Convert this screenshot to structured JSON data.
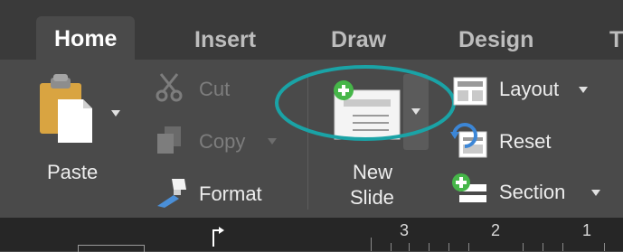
{
  "tabs": {
    "home": "Home",
    "insert": "Insert",
    "draw": "Draw",
    "design": "Design",
    "partial": "T"
  },
  "clipboard": {
    "paste_label": "Paste",
    "cut_label": "Cut",
    "copy_label": "Copy",
    "format_label": "Format"
  },
  "slides": {
    "new_slide_line1": "New",
    "new_slide_line2": "Slide",
    "layout_label": "Layout",
    "reset_label": "Reset",
    "section_label": "Section"
  },
  "ruler": {
    "marks": [
      "3",
      "2",
      "1"
    ]
  },
  "colors": {
    "highlight_circle": "#1aa3a6",
    "accent_green": "#46b649",
    "tab_bar_bg": "#3a3a3a",
    "ribbon_bg": "#4a4a4a"
  },
  "icons": [
    "clipboard-icon",
    "scissors-icon",
    "copy-icon",
    "format-painter-icon",
    "new-slide-icon",
    "layout-icon",
    "reset-icon",
    "section-icon",
    "indent-marker-icon"
  ]
}
